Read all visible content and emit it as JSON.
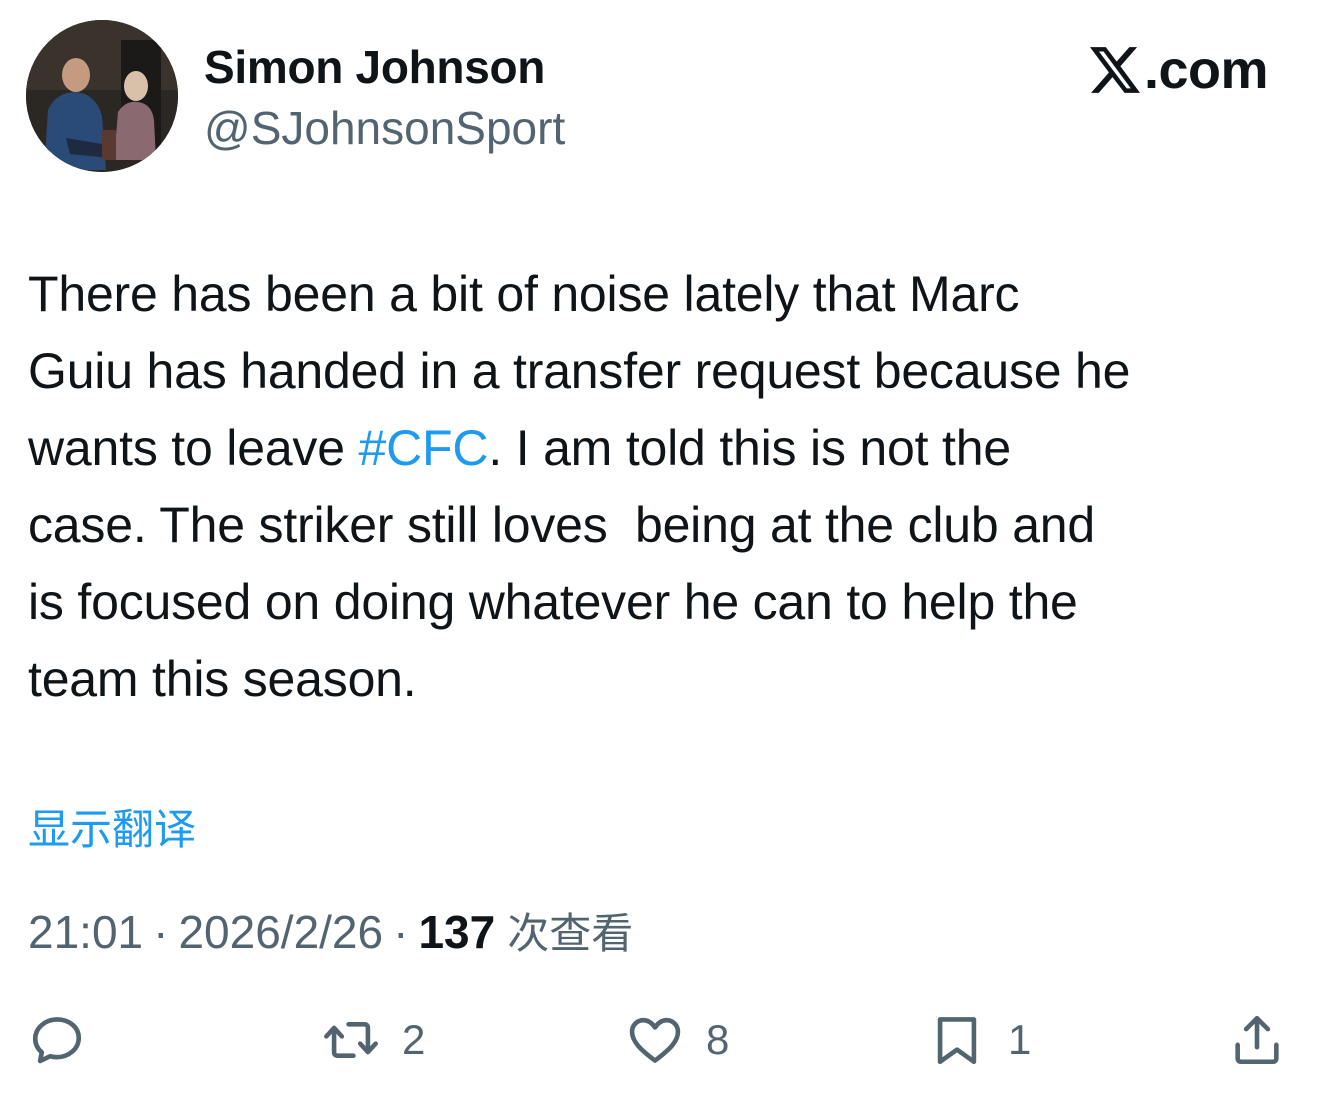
{
  "author": {
    "display_name": "Simon Johnson",
    "handle": "@SJohnsonSport"
  },
  "brand": {
    "domain": ".com",
    "icon": "x-logo-icon"
  },
  "tweet": {
    "lines": [
      "There has been a bit of noise lately that Marc",
      "Guiu has handed in a transfer request because he",
      "wants to leave ",
      "#CFC",
      ". I am told this is not the",
      "case. The striker still loves  being at the club and",
      "is focused on doing whatever he can to help the",
      "team this season."
    ]
  },
  "translate_label": "显示翻译",
  "meta": {
    "time": "21:01",
    "separator": "·",
    "date": "2026/2/26",
    "views_count": "137",
    "views_label": "次查看"
  },
  "actions": {
    "reply": {
      "icon": "reply-icon"
    },
    "retweet": {
      "icon": "retweet-icon",
      "count": "2"
    },
    "like": {
      "icon": "heart-icon",
      "count": "8"
    },
    "bookmark": {
      "icon": "bookmark-icon",
      "count": "1"
    },
    "share": {
      "icon": "share-icon"
    }
  },
  "colors": {
    "accent": "#1d9bf0",
    "text": "#0f1419",
    "secondary": "#536471"
  }
}
